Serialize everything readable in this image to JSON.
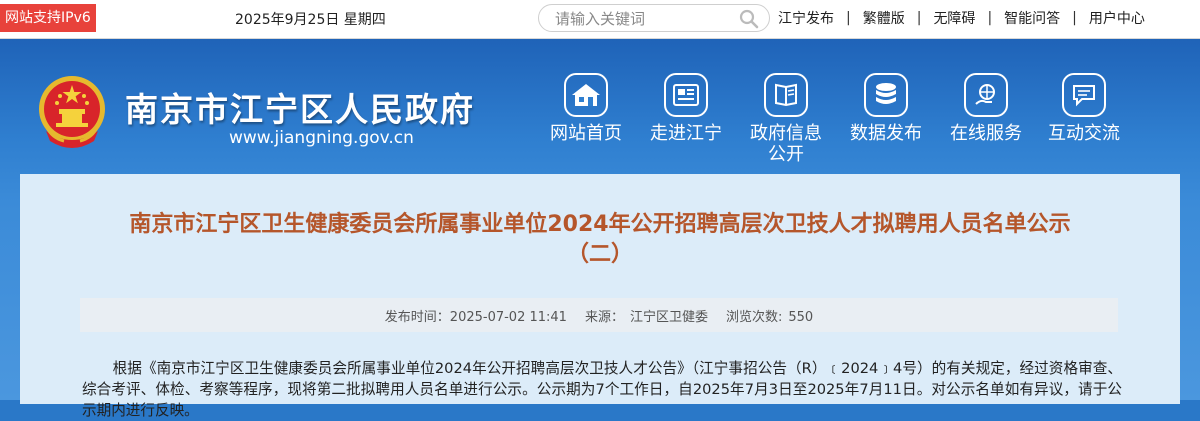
{
  "topbar": {
    "ipv6_badge": "网站支持IPv6",
    "date": "2025年9月25日 星期四",
    "search_placeholder": "请输入关键词",
    "links": [
      "江宁发布",
      "繁體版",
      "无障碍",
      "智能问答",
      "用户中心"
    ]
  },
  "header": {
    "site_title": "南京市江宁区人民政府",
    "site_url": "www.jiangning.gov.cn",
    "nav": [
      {
        "label": "网站首页",
        "icon": "home-icon"
      },
      {
        "label": "走进江宁",
        "icon": "newspaper-icon"
      },
      {
        "label": "政府信息公开",
        "icon": "book-icon"
      },
      {
        "label": "数据发布",
        "icon": "database-icon"
      },
      {
        "label": "在线服务",
        "icon": "hand-globe-icon"
      },
      {
        "label": "互动交流",
        "icon": "chat-icon"
      }
    ]
  },
  "article": {
    "title_line1": "南京市江宁区卫生健康委员会所属事业单位2024年公开招聘高层次卫技人才拟聘用人员名单公示",
    "title_line2": "（二）",
    "publish_label": "发布时间：",
    "publish_time": "2025-07-02 11:41",
    "source_label": "来源：",
    "source": "江宁区卫健委",
    "views_label": "浏览次数:",
    "views": "550",
    "body": "根据《南京市江宁区卫生健康委员会所属事业单位2024年公开招聘高层次卫技人才公告》（江宁事招公告（R）﹝2024﹞4号）的有关规定，经过资格审查、综合考评、体检、考察等程序，现将第二批拟聘用人员名单进行公示。公示期为7个工作日，自2025年7月3日至2025年7月11日。对公示名单如有异议，请于公示期内进行反映。"
  },
  "colors": {
    "header_blue": "#2f7fd0",
    "title_orange": "#b5562b",
    "ipv6_red": "#e8423b",
    "content_bg": "#dcecf9"
  }
}
